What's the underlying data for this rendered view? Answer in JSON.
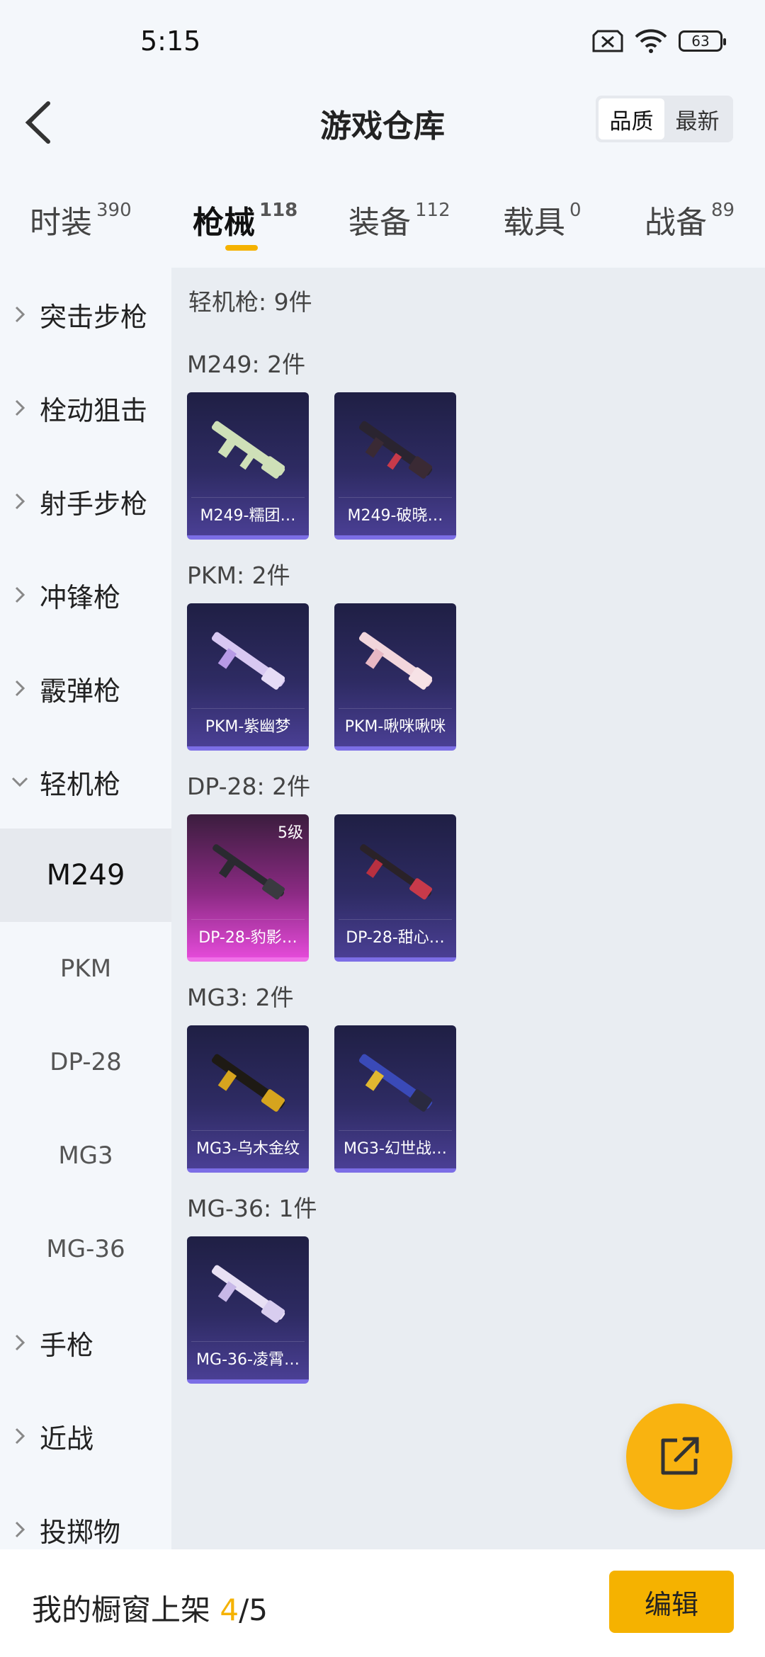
{
  "status": {
    "time": "5:15",
    "battery": "63"
  },
  "header": {
    "title": "游戏仓库",
    "sort_quality": "品质",
    "sort_newest": "最新"
  },
  "tabs": [
    {
      "label": "时装",
      "count": "390"
    },
    {
      "label": "枪械",
      "count": "118"
    },
    {
      "label": "装备",
      "count": "112"
    },
    {
      "label": "载具",
      "count": "0"
    },
    {
      "label": "战备",
      "count": "89"
    }
  ],
  "sidebar": {
    "items": [
      "突击步枪",
      "栓动狙击",
      "射手步枪",
      "冲锋枪",
      "霰弹枪",
      "轻机枪"
    ],
    "subitems": [
      "M249",
      "PKM",
      "DP-28",
      "MG3",
      "MG-36"
    ],
    "after": [
      "手枪",
      "近战",
      "投掷物"
    ]
  },
  "main": {
    "summary": "轻机枪: 9件",
    "groups": [
      {
        "title": "M249: 2件",
        "items": [
          {
            "name": "M249-糯团…"
          },
          {
            "name": "M249-破晓…"
          }
        ]
      },
      {
        "title": "PKM: 2件",
        "items": [
          {
            "name": "PKM-紫幽梦"
          },
          {
            "name": "PKM-啾咪啾咪"
          }
        ]
      },
      {
        "title": "DP-28: 2件",
        "items": [
          {
            "name": "DP-28-豹影…",
            "level": "5级"
          },
          {
            "name": "DP-28-甜心…"
          }
        ]
      },
      {
        "title": "MG3: 2件",
        "items": [
          {
            "name": "MG3-乌木金纹"
          },
          {
            "name": "MG3-幻世战…"
          }
        ]
      },
      {
        "title": "MG-36: 1件",
        "items": [
          {
            "name": "MG-36-凌霄…"
          }
        ]
      }
    ]
  },
  "bottom": {
    "label": "我的橱窗上架 ",
    "current": "4",
    "total": "/5",
    "edit": "编辑"
  },
  "colors": {
    "accent": "#f5b200",
    "card_purple": "#2e2b63",
    "card_pink": "#e34ad8"
  }
}
